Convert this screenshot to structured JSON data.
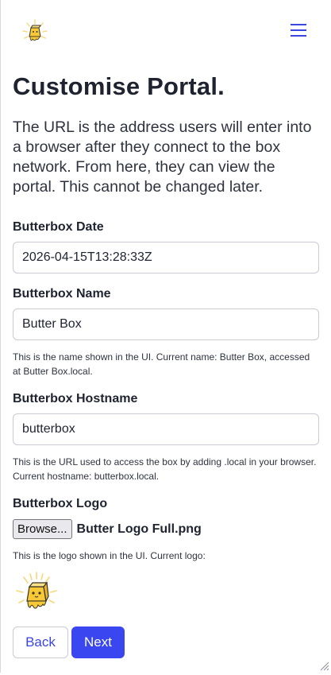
{
  "header": {
    "logo_icon": "butter-mascot-icon",
    "menu_icon": "hamburger-menu-icon"
  },
  "page": {
    "title": "Customise Portal.",
    "lead": "The URL is the address users will enter into a browser after they connect to the box network. From here, they can view the portal. This cannot be changed later."
  },
  "form": {
    "date": {
      "label": "Butterbox Date",
      "value": "2026-04-15T13:28:33Z"
    },
    "name": {
      "label": "Butterbox Name",
      "value": "Butter Box",
      "help": "This is the name shown in the UI. Current name: Butter Box, accessed at Butter Box.local."
    },
    "hostname": {
      "label": "Butterbox Hostname",
      "value": "butterbox",
      "help": "This is the URL used to access the box by adding .local in your browser. Current hostname: butterbox.local."
    },
    "logo": {
      "label": "Butterbox Logo",
      "browse_label": "Browse...",
      "file_name": "Butter Logo Full.png",
      "help": "This is the logo shown in the UI. Current logo:"
    }
  },
  "actions": {
    "back_label": "Back",
    "next_label": "Next"
  },
  "colors": {
    "accent": "#3a46f0",
    "text": "#1f2330",
    "border": "#c8cbd2"
  }
}
